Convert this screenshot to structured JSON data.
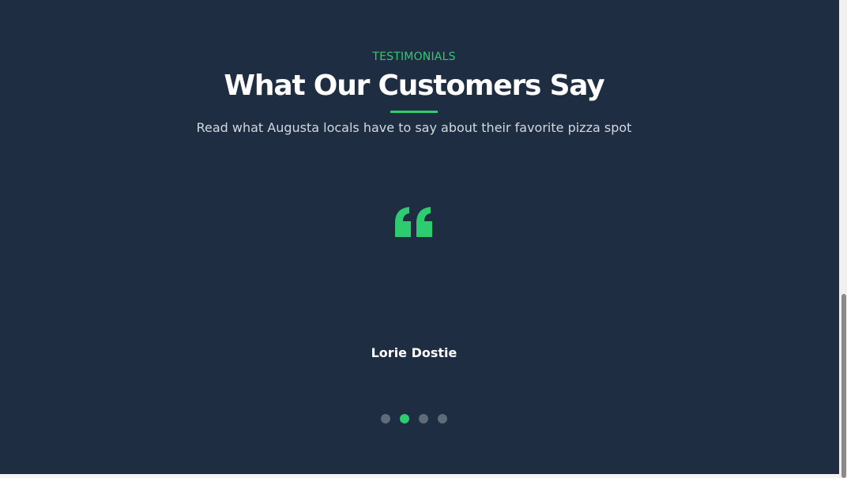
{
  "testimonials": {
    "eyebrow": "TESTIMONIALS",
    "title": "What Our Customers Say",
    "subtitle": "Read what Augusta locals have to say about their favorite pizza spot",
    "quote_icon": "quote-icon",
    "active_quote": {
      "author": "Lorie Dostie"
    },
    "dots": [
      {
        "label": "Slide 1",
        "active": false
      },
      {
        "label": "Slide 2",
        "active": true
      },
      {
        "label": "Slide 3",
        "active": false
      },
      {
        "label": "Slide 4",
        "active": false
      }
    ]
  },
  "colors": {
    "background": "#1e2d41",
    "accent": "#2ecc71",
    "heading": "#ffffff",
    "subtitle": "#d3d8df",
    "dot_inactive": "#5f6b7a"
  }
}
